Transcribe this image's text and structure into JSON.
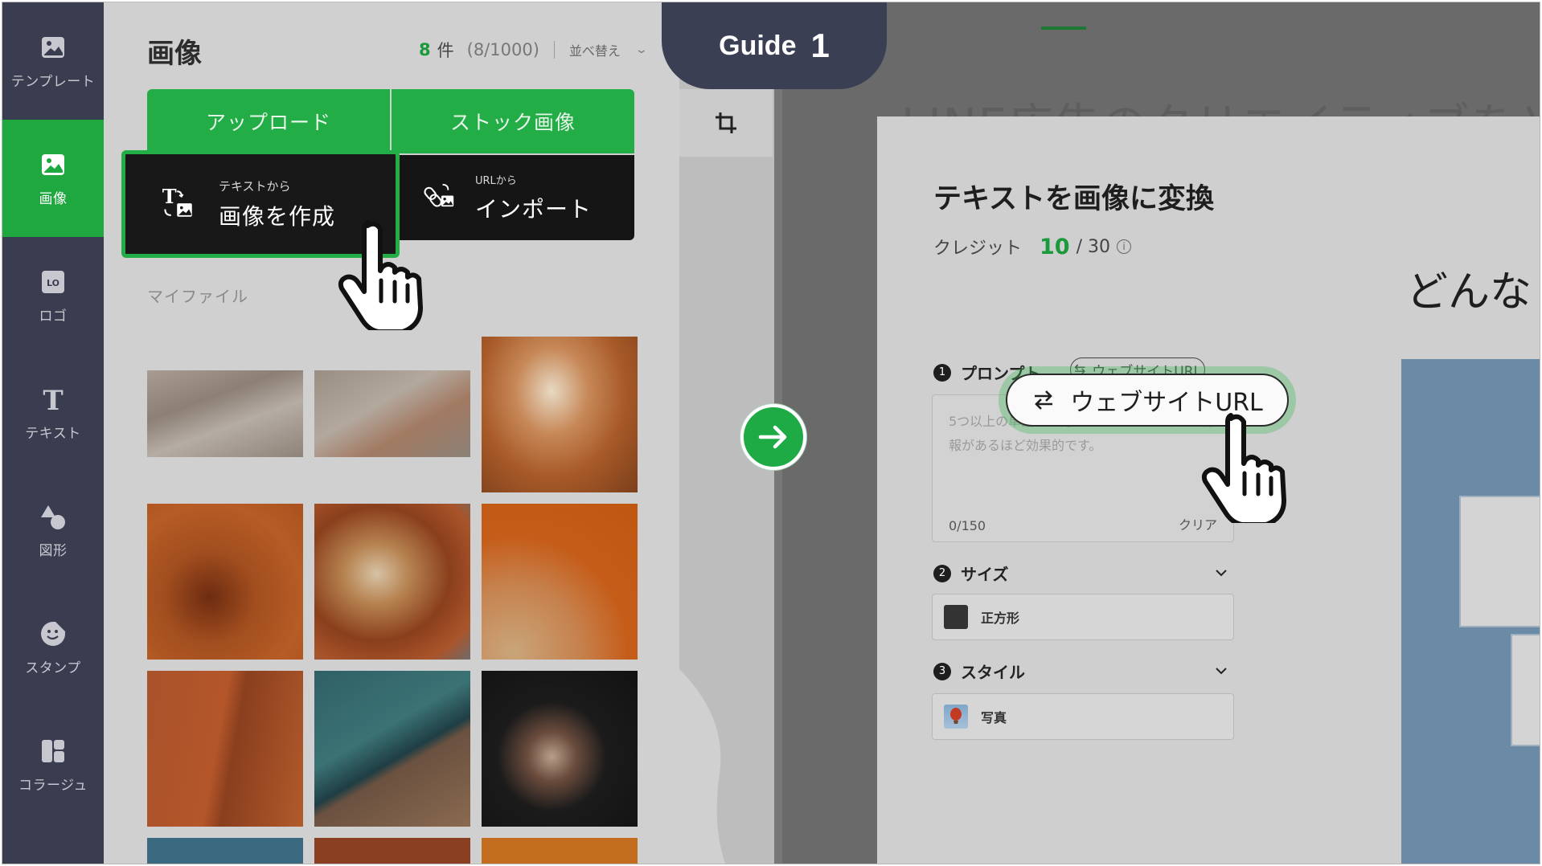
{
  "nav": {
    "items": [
      {
        "label": "テンプレート",
        "icon": "image-icon",
        "active": false
      },
      {
        "label": "画像",
        "icon": "image-icon",
        "active": true
      },
      {
        "label": "ロゴ",
        "icon": "logo-icon",
        "active": false
      },
      {
        "label": "テキスト",
        "icon": "text-icon",
        "active": false
      },
      {
        "label": "図形",
        "icon": "shapes-icon",
        "active": false
      },
      {
        "label": "スタンプ",
        "icon": "sticker-icon",
        "active": false
      },
      {
        "label": "コラージュ",
        "icon": "collage-icon",
        "active": false
      }
    ]
  },
  "panel": {
    "title": "画像",
    "count": "8",
    "count_unit": "件",
    "count_detail": "(8/1000)",
    "sort_label": "並べ替え",
    "upload_label": "アップロード",
    "stock_label": "ストック画像",
    "text2img_small": "テキストから",
    "text2img_big": "画像を作成",
    "import_small": "URLから",
    "import_big": "インポート",
    "myfiles_label": "マイファイル"
  },
  "guide": {
    "word": "Guide",
    "number": "1"
  },
  "editor": {
    "ghost_title": "LINE広告のクリエイティブをど",
    "card_title": "テキストを画像に変換",
    "credit_label": "クレジット",
    "credit_value": "10",
    "credit_total": "/ 30",
    "credit_info": "i",
    "step1_num": "1",
    "step1_label": "プロンプト",
    "url_chip_label": "ウェブサイトURL",
    "prompt_placeholder": "5つ以上の単語で入力してください。詳しい情報があるほど効果的です。",
    "prompt_counter": "0/150",
    "prompt_clear": "クリア",
    "step2_num": "2",
    "step2_label": "サイズ",
    "size_value": "正方形",
    "step3_num": "3",
    "step3_label": "スタイル",
    "style_value": "写真",
    "canvas_text": "どんな"
  },
  "colors": {
    "accent_green": "#22ad46",
    "nav_bg": "#3a3d50",
    "guide_bg": "#3b3f54"
  }
}
